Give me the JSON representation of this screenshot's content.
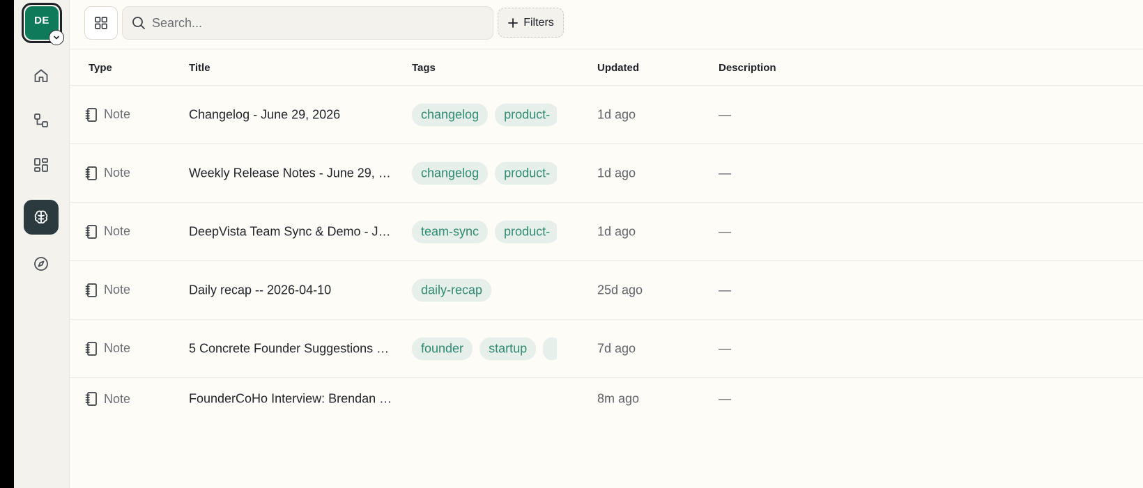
{
  "user": {
    "initials": "DE"
  },
  "sidebar": {
    "items": [
      {
        "name": "home-icon",
        "active": false
      },
      {
        "name": "graph-icon",
        "active": false
      },
      {
        "name": "dashboard-icon",
        "active": false
      },
      {
        "name": "brain-icon",
        "active": true
      },
      {
        "name": "compass-icon",
        "active": false
      }
    ]
  },
  "toolbar": {
    "search_placeholder": "Search...",
    "filters_label": "Filters"
  },
  "table": {
    "columns": [
      "Type",
      "Title",
      "Tags",
      "Updated",
      "Description"
    ],
    "rows": [
      {
        "type": "Note",
        "title": "Changelog - June 29, 2026",
        "tags": [
          "changelog",
          "product-"
        ],
        "updated": "1d ago",
        "description": "—"
      },
      {
        "type": "Note",
        "title": "Weekly Release Notes - June 29, …",
        "tags": [
          "changelog",
          "product-"
        ],
        "updated": "1d ago",
        "description": "—"
      },
      {
        "type": "Note",
        "title": "DeepVista Team Sync & Demo - J…",
        "tags": [
          "team-sync",
          "product-"
        ],
        "updated": "1d ago",
        "description": "—"
      },
      {
        "type": "Note",
        "title": "Daily recap -- 2026-04-10",
        "tags": [
          "daily-recap"
        ],
        "updated": "25d ago",
        "description": "—"
      },
      {
        "type": "Note",
        "title": "5 Concrete Founder Suggestions …",
        "tags": [
          "founder",
          "startup",
          ""
        ],
        "updated": "7d ago",
        "description": "—"
      },
      {
        "type": "Note",
        "title": "FounderCoHo Interview: Brendan …",
        "tags": [],
        "updated": "8m ago",
        "description": "—"
      }
    ]
  },
  "colors": {
    "accent": "#0f7a5a",
    "tag_bg": "#e6efe9",
    "tag_text": "#2e8a72",
    "active_nav": "#2b3a3e"
  }
}
